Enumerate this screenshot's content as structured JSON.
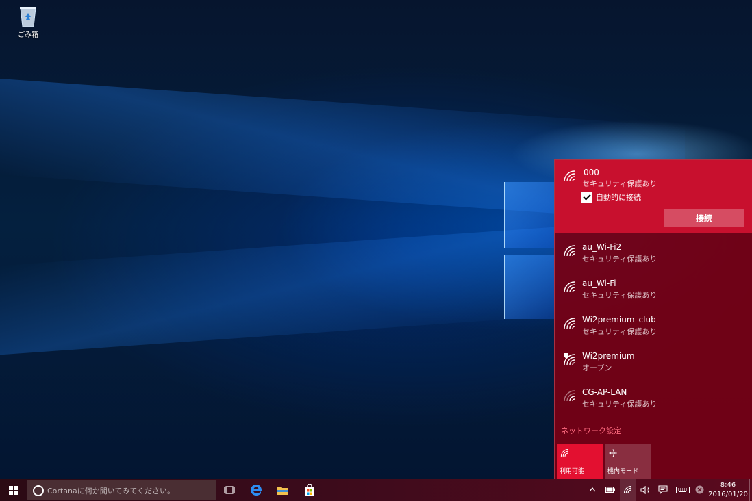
{
  "desktop": {
    "icons": [
      {
        "label": "ごみ箱",
        "icon": "recycle-bin-icon"
      }
    ]
  },
  "network_flyout": {
    "selected": {
      "name": "000",
      "status": "セキュリティ保護あり",
      "auto_connect_label": "自動的に接続",
      "auto_connect_checked": true,
      "connect_label": "接続"
    },
    "networks": [
      {
        "name": "au_Wi-Fi2",
        "status": "セキュリティ保護あり"
      },
      {
        "name": "au_Wi-Fi",
        "status": "セキュリティ保護あり"
      },
      {
        "name": "Wi2premium_club",
        "status": "セキュリティ保護あり"
      },
      {
        "name": "Wi2premium",
        "status": "オープン"
      },
      {
        "name": "CG-AP-LAN",
        "status": "セキュリティ保護あり"
      }
    ],
    "settings_link": "ネットワーク設定",
    "quick_actions": [
      {
        "label": "利用可能",
        "icon": "wifi-icon"
      },
      {
        "label": "機内モード",
        "icon": "airplane-icon"
      }
    ]
  },
  "taskbar": {
    "search_placeholder": "Cortanaに何か聞いてみてください。",
    "pinned": [
      "task-view-icon",
      "edge-icon",
      "file-explorer-icon",
      "store-icon"
    ],
    "tray": [
      "chevron-up-icon",
      "battery-icon",
      "wifi-icon",
      "volume-icon",
      "action-center-icon",
      "keyboard-icon",
      "close-circle-icon"
    ],
    "clock": {
      "time": "8:46",
      "date": "2016/01/20"
    }
  },
  "colors": {
    "flyout_bg": "#780014",
    "selected_bg": "#c8102e",
    "accent": "#e31030",
    "link": "#ff6b80"
  }
}
